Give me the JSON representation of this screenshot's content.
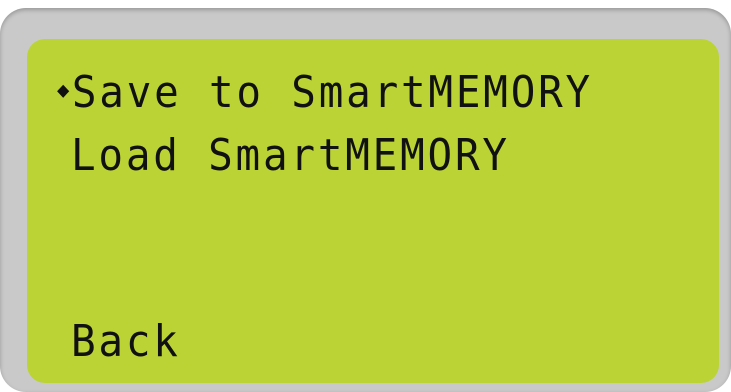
{
  "lcd_menu": {
    "cursor_icon": "diamond-cursor-icon",
    "cursor_glyph": "◆",
    "items": [
      {
        "label": "Save to SmartMEMORY",
        "selected": true
      },
      {
        "label": "Load SmartMEMORY",
        "selected": false
      },
      {
        "label": "Back",
        "selected": false
      }
    ]
  },
  "colors": {
    "lcd_background": "#bcd335",
    "bezel": "#c9c9c9",
    "text": "#111111"
  }
}
